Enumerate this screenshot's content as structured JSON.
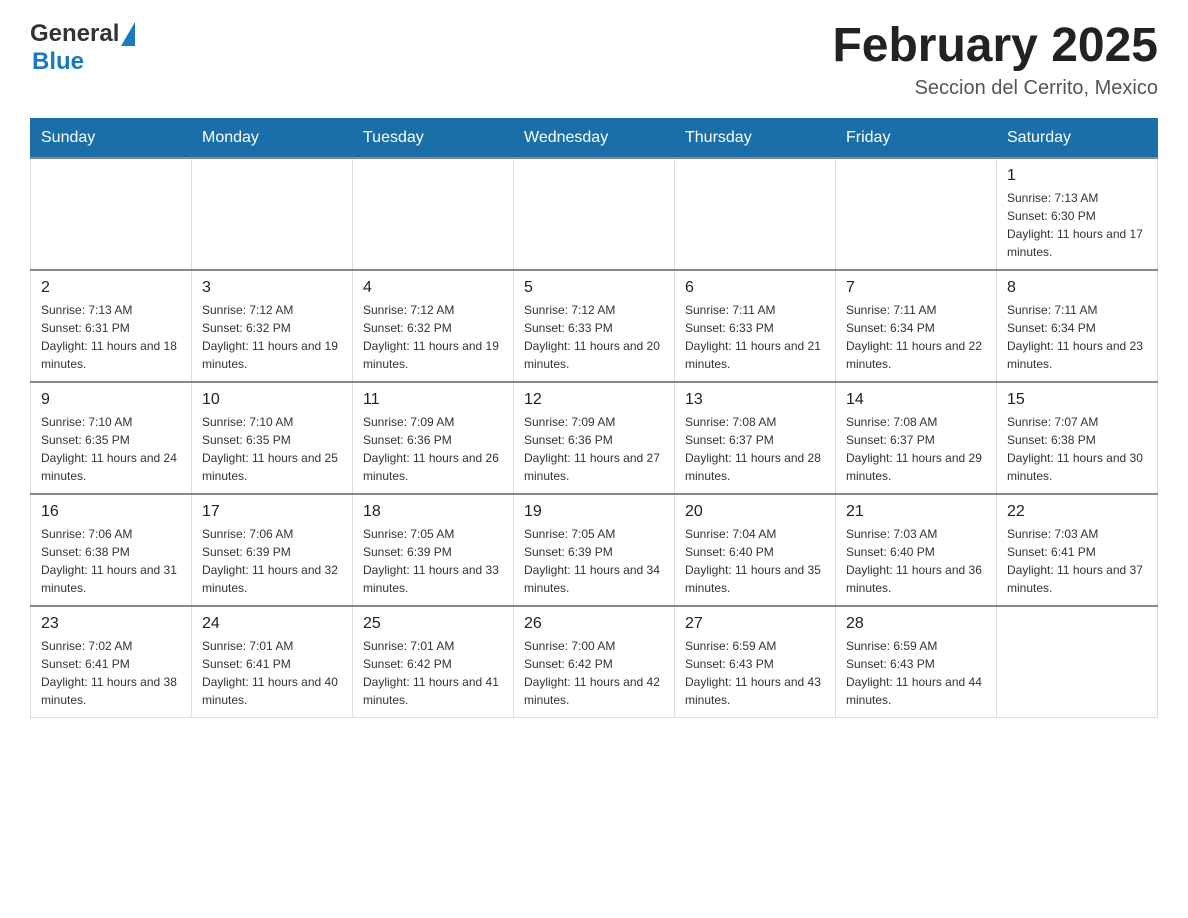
{
  "header": {
    "logo_general": "General",
    "logo_blue": "Blue",
    "month_title": "February 2025",
    "subtitle": "Seccion del Cerrito, Mexico"
  },
  "days_of_week": [
    "Sunday",
    "Monday",
    "Tuesday",
    "Wednesday",
    "Thursday",
    "Friday",
    "Saturday"
  ],
  "weeks": [
    [
      {
        "day": "",
        "info": ""
      },
      {
        "day": "",
        "info": ""
      },
      {
        "day": "",
        "info": ""
      },
      {
        "day": "",
        "info": ""
      },
      {
        "day": "",
        "info": ""
      },
      {
        "day": "",
        "info": ""
      },
      {
        "day": "1",
        "info": "Sunrise: 7:13 AM\nSunset: 6:30 PM\nDaylight: 11 hours and 17 minutes."
      }
    ],
    [
      {
        "day": "2",
        "info": "Sunrise: 7:13 AM\nSunset: 6:31 PM\nDaylight: 11 hours and 18 minutes."
      },
      {
        "day": "3",
        "info": "Sunrise: 7:12 AM\nSunset: 6:32 PM\nDaylight: 11 hours and 19 minutes."
      },
      {
        "day": "4",
        "info": "Sunrise: 7:12 AM\nSunset: 6:32 PM\nDaylight: 11 hours and 19 minutes."
      },
      {
        "day": "5",
        "info": "Sunrise: 7:12 AM\nSunset: 6:33 PM\nDaylight: 11 hours and 20 minutes."
      },
      {
        "day": "6",
        "info": "Sunrise: 7:11 AM\nSunset: 6:33 PM\nDaylight: 11 hours and 21 minutes."
      },
      {
        "day": "7",
        "info": "Sunrise: 7:11 AM\nSunset: 6:34 PM\nDaylight: 11 hours and 22 minutes."
      },
      {
        "day": "8",
        "info": "Sunrise: 7:11 AM\nSunset: 6:34 PM\nDaylight: 11 hours and 23 minutes."
      }
    ],
    [
      {
        "day": "9",
        "info": "Sunrise: 7:10 AM\nSunset: 6:35 PM\nDaylight: 11 hours and 24 minutes."
      },
      {
        "day": "10",
        "info": "Sunrise: 7:10 AM\nSunset: 6:35 PM\nDaylight: 11 hours and 25 minutes."
      },
      {
        "day": "11",
        "info": "Sunrise: 7:09 AM\nSunset: 6:36 PM\nDaylight: 11 hours and 26 minutes."
      },
      {
        "day": "12",
        "info": "Sunrise: 7:09 AM\nSunset: 6:36 PM\nDaylight: 11 hours and 27 minutes."
      },
      {
        "day": "13",
        "info": "Sunrise: 7:08 AM\nSunset: 6:37 PM\nDaylight: 11 hours and 28 minutes."
      },
      {
        "day": "14",
        "info": "Sunrise: 7:08 AM\nSunset: 6:37 PM\nDaylight: 11 hours and 29 minutes."
      },
      {
        "day": "15",
        "info": "Sunrise: 7:07 AM\nSunset: 6:38 PM\nDaylight: 11 hours and 30 minutes."
      }
    ],
    [
      {
        "day": "16",
        "info": "Sunrise: 7:06 AM\nSunset: 6:38 PM\nDaylight: 11 hours and 31 minutes."
      },
      {
        "day": "17",
        "info": "Sunrise: 7:06 AM\nSunset: 6:39 PM\nDaylight: 11 hours and 32 minutes."
      },
      {
        "day": "18",
        "info": "Sunrise: 7:05 AM\nSunset: 6:39 PM\nDaylight: 11 hours and 33 minutes."
      },
      {
        "day": "19",
        "info": "Sunrise: 7:05 AM\nSunset: 6:39 PM\nDaylight: 11 hours and 34 minutes."
      },
      {
        "day": "20",
        "info": "Sunrise: 7:04 AM\nSunset: 6:40 PM\nDaylight: 11 hours and 35 minutes."
      },
      {
        "day": "21",
        "info": "Sunrise: 7:03 AM\nSunset: 6:40 PM\nDaylight: 11 hours and 36 minutes."
      },
      {
        "day": "22",
        "info": "Sunrise: 7:03 AM\nSunset: 6:41 PM\nDaylight: 11 hours and 37 minutes."
      }
    ],
    [
      {
        "day": "23",
        "info": "Sunrise: 7:02 AM\nSunset: 6:41 PM\nDaylight: 11 hours and 38 minutes."
      },
      {
        "day": "24",
        "info": "Sunrise: 7:01 AM\nSunset: 6:41 PM\nDaylight: 11 hours and 40 minutes."
      },
      {
        "day": "25",
        "info": "Sunrise: 7:01 AM\nSunset: 6:42 PM\nDaylight: 11 hours and 41 minutes."
      },
      {
        "day": "26",
        "info": "Sunrise: 7:00 AM\nSunset: 6:42 PM\nDaylight: 11 hours and 42 minutes."
      },
      {
        "day": "27",
        "info": "Sunrise: 6:59 AM\nSunset: 6:43 PM\nDaylight: 11 hours and 43 minutes."
      },
      {
        "day": "28",
        "info": "Sunrise: 6:59 AM\nSunset: 6:43 PM\nDaylight: 11 hours and 44 minutes."
      },
      {
        "day": "",
        "info": ""
      }
    ]
  ]
}
